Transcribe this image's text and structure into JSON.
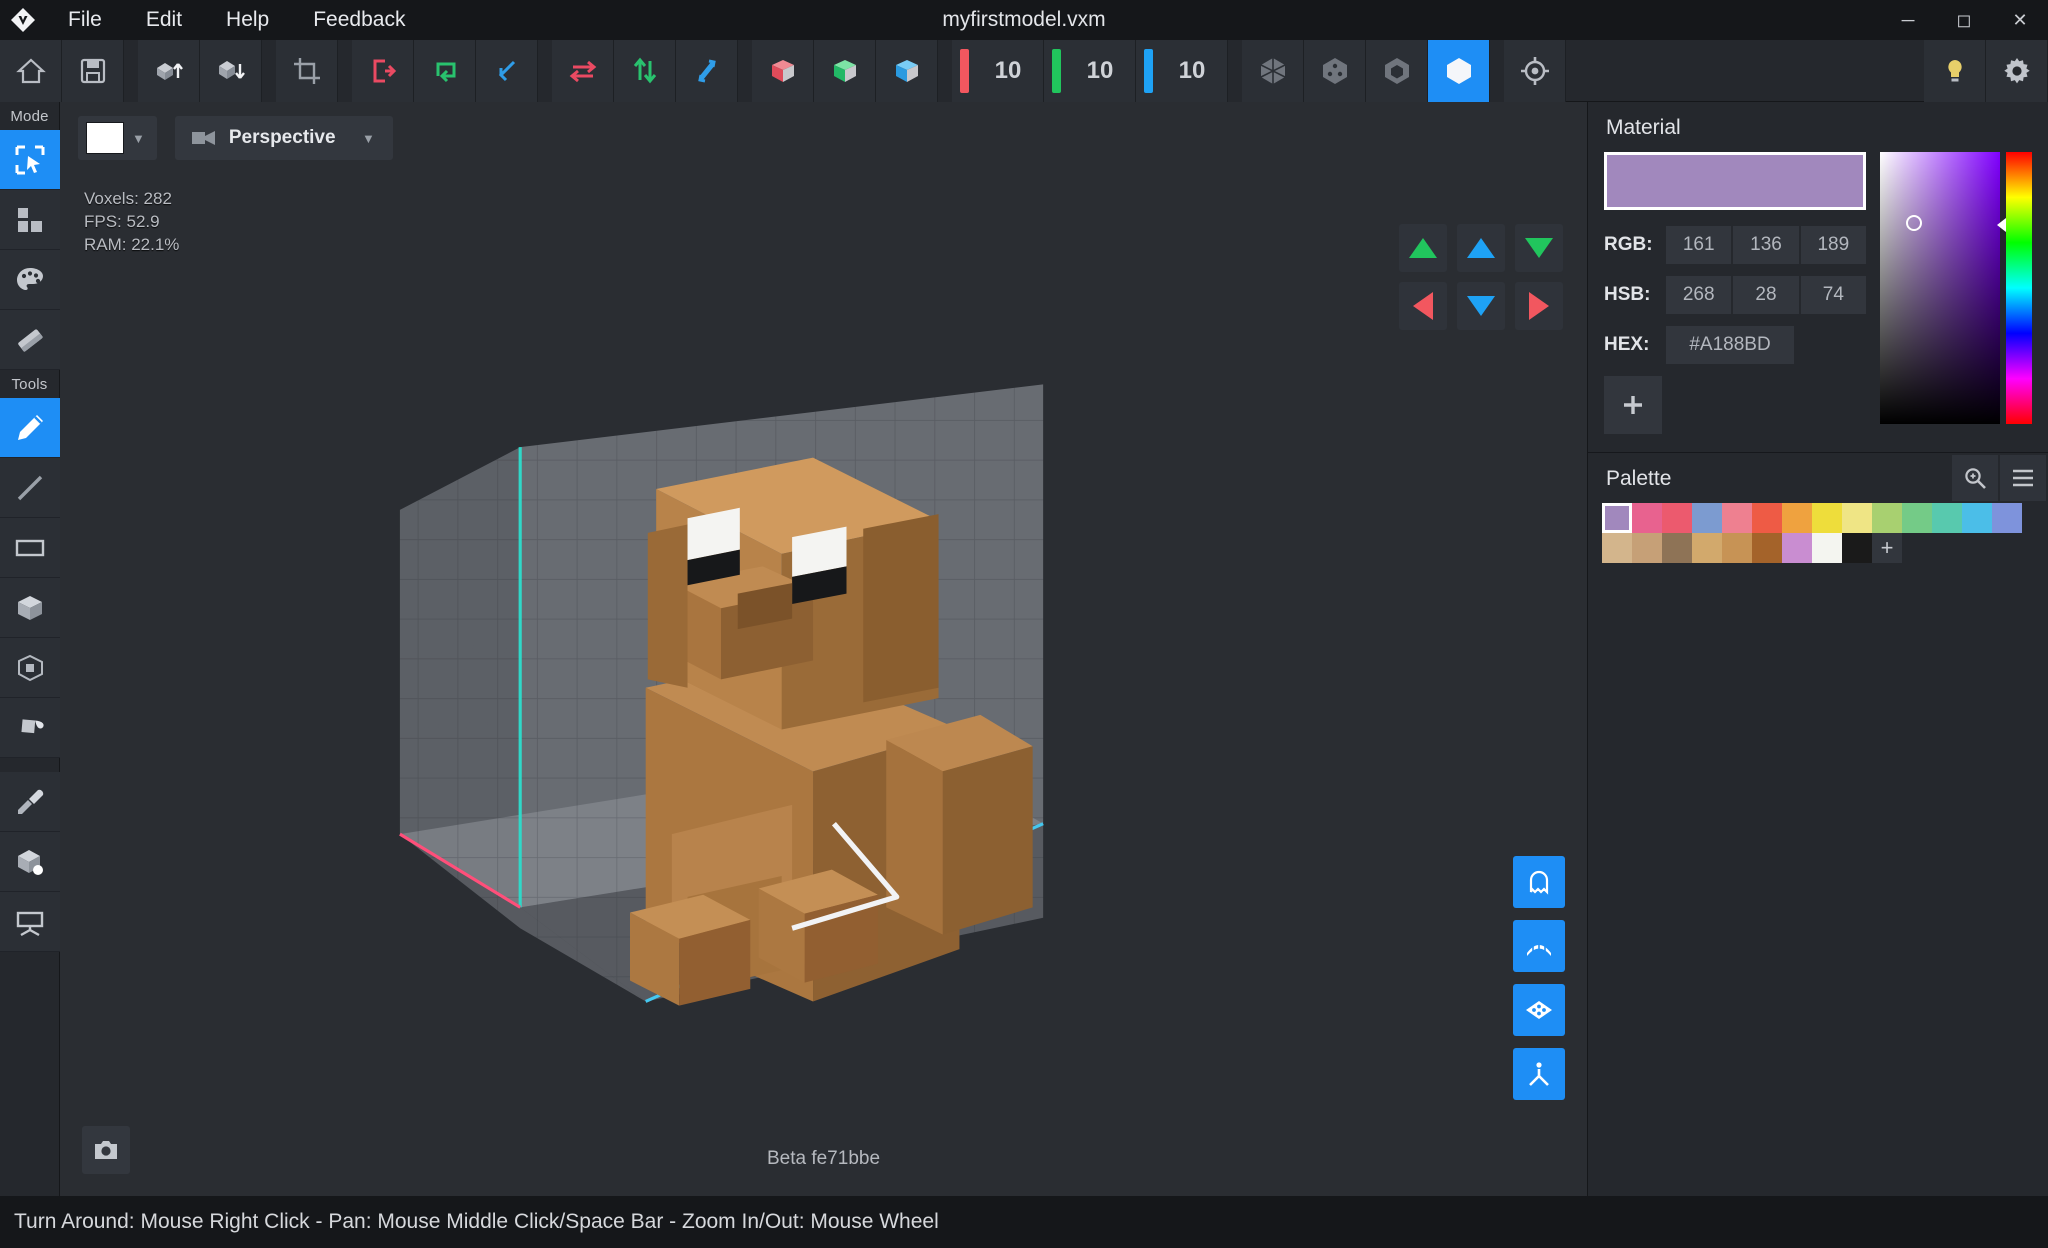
{
  "window": {
    "title": "myfirstmodel.vxm",
    "logo_icon": "voxel-diamond-logo",
    "minimize_icon": "minimize-icon",
    "maximize_icon": "maximize-icon",
    "close_icon": "close-icon"
  },
  "menu": [
    {
      "label": "File"
    },
    {
      "label": "Edit"
    },
    {
      "label": "Help"
    },
    {
      "label": "Feedback"
    }
  ],
  "toolbar": {
    "groups": [
      {
        "items": [
          {
            "icon": "home-icon",
            "name": "home-button"
          },
          {
            "icon": "save-icon",
            "name": "save-button"
          }
        ]
      },
      {
        "items": [
          {
            "icon": "import-model-icon",
            "name": "import-button"
          },
          {
            "icon": "export-model-icon",
            "name": "export-button"
          }
        ]
      },
      {
        "items": [
          {
            "icon": "crop-icon",
            "name": "crop-button"
          }
        ]
      },
      {
        "items": [
          {
            "icon": "exit-red-icon",
            "name": "exit-button"
          },
          {
            "icon": "loop-green-icon",
            "name": "loop-button"
          },
          {
            "icon": "undo-blue-icon",
            "name": "undo-button"
          }
        ]
      },
      {
        "items": [
          {
            "icon": "mirror-x-red-icon",
            "name": "mirror-x-button"
          },
          {
            "icon": "mirror-y-green-icon",
            "name": "mirror-y-button"
          },
          {
            "icon": "mirror-z-blue-icon",
            "name": "mirror-z-button"
          }
        ]
      },
      {
        "items": [
          {
            "icon": "cube-red-icon",
            "name": "axis-x-cube-button"
          },
          {
            "icon": "cube-green-icon",
            "name": "axis-y-cube-button"
          },
          {
            "icon": "cube-blue-icon",
            "name": "axis-z-cube-button"
          }
        ]
      }
    ],
    "size_fields": [
      {
        "axis": "x",
        "value": "10",
        "color": "#f2575f"
      },
      {
        "axis": "y",
        "value": "10",
        "color": "#21c55d"
      },
      {
        "axis": "z",
        "value": "10",
        "color": "#1ea2f5"
      }
    ],
    "render_modes": [
      {
        "icon": "wireframe-hex-icon",
        "name": "render-mode-wireframe",
        "active": false
      },
      {
        "icon": "points-hex-icon",
        "name": "render-mode-points",
        "active": false
      },
      {
        "icon": "outline-hex-icon",
        "name": "render-mode-outline",
        "active": false
      },
      {
        "icon": "solid-hex-icon",
        "name": "render-mode-solid",
        "active": true
      }
    ],
    "target": {
      "icon": "target-icon",
      "name": "center-target-button"
    },
    "right": [
      {
        "icon": "lightbulb-icon",
        "name": "lighting-button"
      },
      {
        "icon": "gear-icon",
        "name": "settings-button"
      }
    ]
  },
  "rail": {
    "mode_label": "Mode",
    "modes": [
      {
        "icon": "select-icon",
        "name": "mode-select",
        "active": true
      },
      {
        "icon": "build-blocks-icon",
        "name": "mode-build",
        "active": false
      },
      {
        "icon": "palette-icon",
        "name": "mode-paint",
        "active": false
      },
      {
        "icon": "eraser-icon",
        "name": "mode-erase",
        "active": false
      }
    ],
    "tools_label": "Tools",
    "tools": [
      {
        "icon": "pencil-icon",
        "name": "tool-pencil",
        "active": true
      },
      {
        "icon": "line-icon",
        "name": "tool-line",
        "active": false
      },
      {
        "icon": "rectangle-icon",
        "name": "tool-rectangle",
        "active": false
      },
      {
        "icon": "box-icon",
        "name": "tool-box",
        "active": false
      },
      {
        "icon": "hollow-box-icon",
        "name": "tool-hollow-box",
        "active": false
      },
      {
        "icon": "paint-bucket-icon",
        "name": "tool-paint-bucket",
        "active": false
      }
    ],
    "extras": [
      {
        "icon": "eyedropper-icon",
        "name": "tool-eyedropper",
        "active": false
      },
      {
        "icon": "cube-pick-icon",
        "name": "tool-cube-pick",
        "active": false
      },
      {
        "icon": "camera-view-icon",
        "name": "tool-camera-view",
        "active": false
      }
    ]
  },
  "viewport": {
    "background_swatch": "#ffffff",
    "projection": "Perspective",
    "projection_icon": "camera-icon",
    "caret_icon": "chevron-down-icon",
    "stats": {
      "voxels": "Voxels: 282",
      "fps": "FPS: 52.9",
      "ram": "RAM: 22.1%"
    },
    "nav_buttons": [
      {
        "name": "nav-up-green",
        "icon": "triangle-up-icon",
        "color": "#21c55d",
        "dir": "up"
      },
      {
        "name": "nav-up-blue",
        "icon": "triangle-up-icon",
        "color": "#1ea2f5",
        "dir": "up"
      },
      {
        "name": "nav-down-green",
        "icon": "triangle-down-icon",
        "color": "#21c55d",
        "dir": "down"
      },
      {
        "name": "nav-left-red",
        "icon": "triangle-left-icon",
        "color": "#f2575f",
        "dir": "left"
      },
      {
        "name": "nav-down-blue",
        "icon": "triangle-down-icon",
        "color": "#1ea2f5",
        "dir": "down"
      },
      {
        "name": "nav-right-red",
        "icon": "triangle-right-icon",
        "color": "#f2575f",
        "dir": "right"
      }
    ],
    "side_buttons": [
      {
        "icon": "ghost-icon",
        "name": "toggle-ghost-button"
      },
      {
        "icon": "grid-icon",
        "name": "toggle-grid-button"
      },
      {
        "icon": "plane-icon",
        "name": "toggle-plane-button"
      },
      {
        "icon": "axes-icon",
        "name": "toggle-axes-button"
      }
    ],
    "screenshot_icon": "camera-icon",
    "build": "Beta fe71bbe"
  },
  "material": {
    "title": "Material",
    "preview_color": "#A188BD",
    "rgb_label": "RGB:",
    "rgb": [
      "161",
      "136",
      "189"
    ],
    "hsb_label": "HSB:",
    "hsb": [
      "268",
      "28",
      "74"
    ],
    "hex_label": "HEX:",
    "hex": "#A188BD",
    "add_icon": "plus-icon"
  },
  "palette": {
    "title": "Palette",
    "zoom_icon": "zoom-search-icon",
    "menu_icon": "hamburger-menu-icon",
    "colors": [
      "#A188BD",
      "#E8628F",
      "#EC5A6E",
      "#7C9BD0",
      "#EE8090",
      "#EE5B45",
      "#EFA23F",
      "#EEDD3B",
      "#EFE585",
      "#A8D070",
      "#74CB87",
      "#58C9AE",
      "#4BBEE8",
      "#7E93DC",
      "#D3B58C",
      "#C6A077",
      "#8E7356",
      "#D2A96C",
      "#C79355",
      "#A4632A",
      "#C98DD1",
      "#F4F5F0",
      "#1A1A1A"
    ],
    "selected_index": 0,
    "add_icon": "plus-icon"
  },
  "status_bar": {
    "text": "Turn Around: Mouse Right Click - Pan: Mouse Middle Click/Space Bar - Zoom In/Out: Mouse Wheel"
  }
}
